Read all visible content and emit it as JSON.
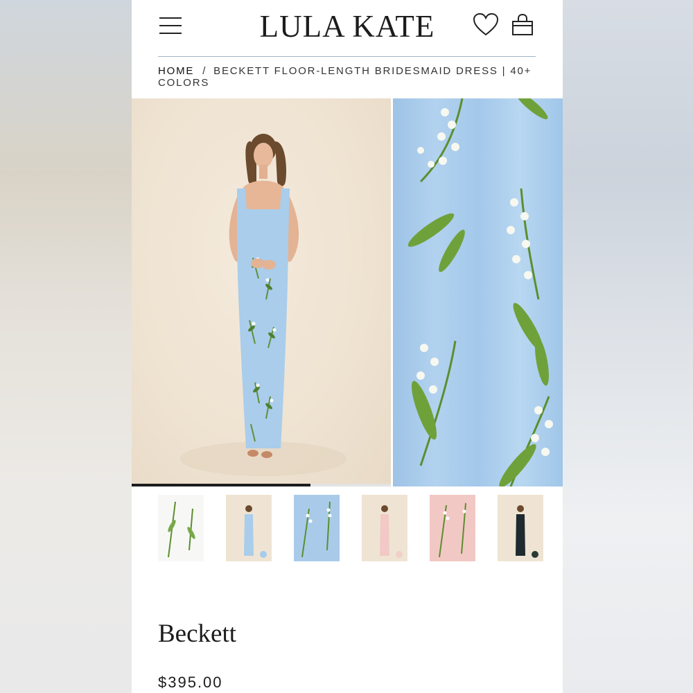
{
  "header": {
    "brand": "LULA KATE",
    "menu_icon": "hamburger-menu-icon",
    "wishlist_icon": "heart-icon",
    "cart_icon": "shopping-bag-icon"
  },
  "breadcrumb": {
    "home": "HOME",
    "separator": "/",
    "current": "BECKETT FLOOR-LENGTH BRIDESMAID DRESS | 40+ COLORS"
  },
  "gallery": {
    "expand_icon": "expand-arrows-icon",
    "progress_fraction": 0.69,
    "thumbnails": [
      {
        "variant": "white-floral-fabric"
      },
      {
        "variant": "blue-dress-model"
      },
      {
        "variant": "blue-floral-fabric"
      },
      {
        "variant": "pink-dress-model"
      },
      {
        "variant": "pink-floral-fabric"
      },
      {
        "variant": "navy-dress-model"
      }
    ]
  },
  "product": {
    "title": "Beckett",
    "price": "$395.00"
  },
  "colors": {
    "dress_blue": "#a9cdeb",
    "leaf_green": "#5f8f3a",
    "text_dark": "#1b1b1b",
    "divider": "#9fb3c4"
  }
}
